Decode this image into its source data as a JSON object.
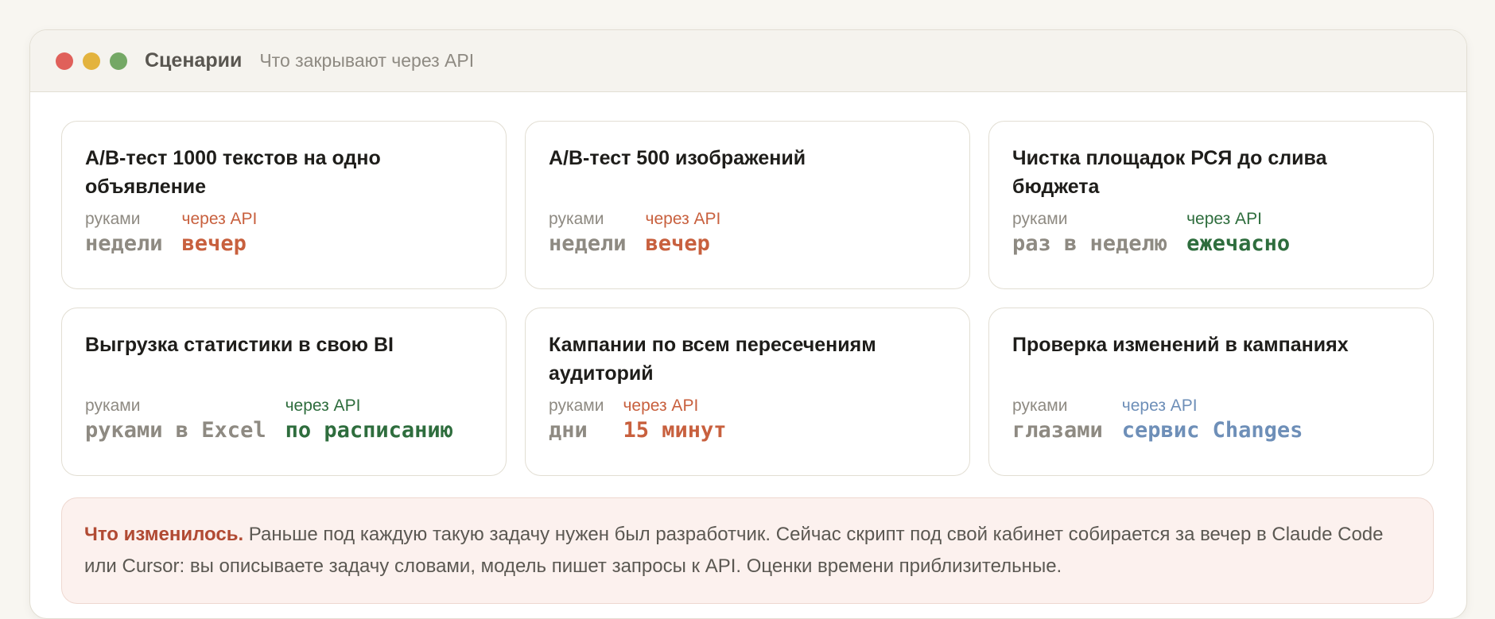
{
  "window": {
    "title": "Сценарии",
    "subtitle": "Что закрывают через API"
  },
  "colors": {
    "orange": "#c8603e",
    "green": "#2e6d3d",
    "blue": "#6e8fb8",
    "muted": "#8e8a82"
  },
  "cards": [
    {
      "title": "A/B-тест 1000 текстов на одно объявление",
      "manual_label": "руками",
      "manual_value": "недели",
      "api_label": "через API",
      "api_value": "вечер",
      "api_color": "orange"
    },
    {
      "title": "A/B-тест 500 изображений",
      "manual_label": "руками",
      "manual_value": "недели",
      "api_label": "через API",
      "api_value": "вечер",
      "api_color": "orange"
    },
    {
      "title": "Чистка площадок РСЯ до слива бюджета",
      "manual_label": "руками",
      "manual_value": "раз в неделю",
      "api_label": "через API",
      "api_value": "ежечасно",
      "api_color": "green"
    },
    {
      "title": "Выгрузка статистики в свою BI",
      "manual_label": "руками",
      "manual_value": "руками в Excel",
      "api_label": "через API",
      "api_value": "по расписанию",
      "api_color": "green"
    },
    {
      "title": "Кампании по всем пересечениям аудиторий",
      "manual_label": "руками",
      "manual_value": "дни",
      "api_label": "через API",
      "api_value": "15 минут",
      "api_color": "orange"
    },
    {
      "title": "Проверка изменений в кампаниях",
      "manual_label": "руками",
      "manual_value": "глазами",
      "api_label": "через API",
      "api_value": "сервис Changes",
      "api_color": "blue"
    }
  ],
  "note": {
    "lead": "Что изменилось.",
    "text": "Раньше под каждую такую задачу нужен был разработчик. Сейчас скрипт под свой кабинет собирается за вечер в Claude Code или Cursor: вы описываете задачу словами, модель пишет запросы к API. Оценки времени приблизительные."
  }
}
